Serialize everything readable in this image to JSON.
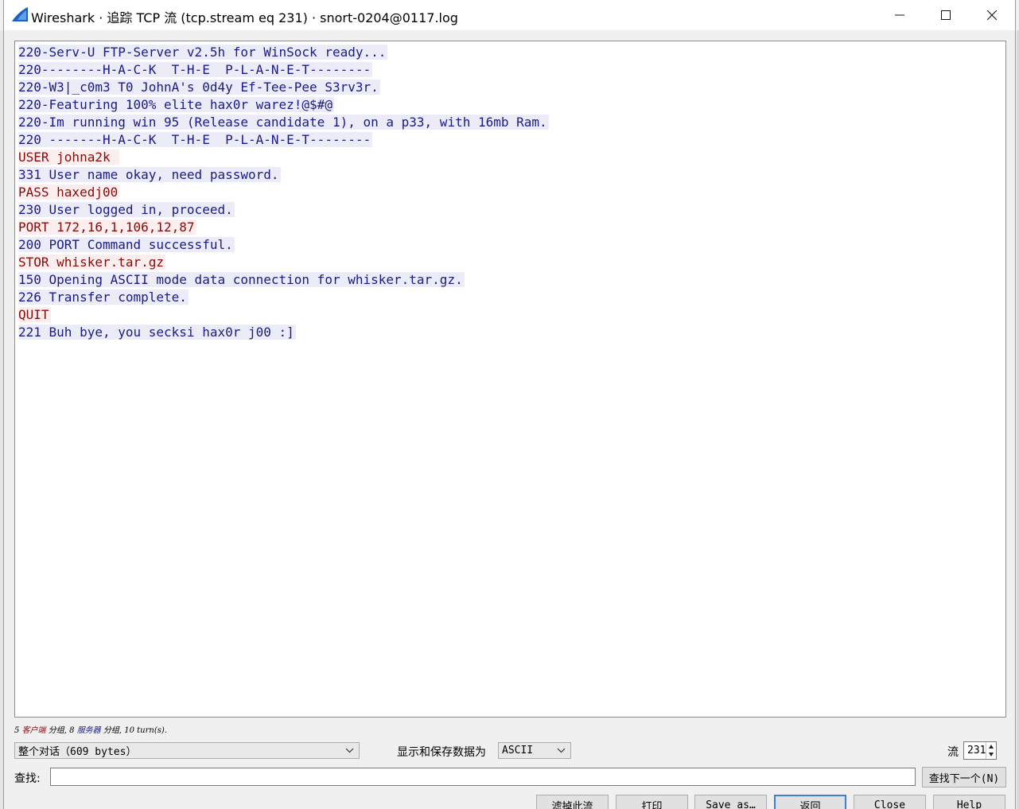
{
  "window": {
    "title": "Wireshark · 追踪 TCP 流 (tcp.stream eq 231) · snort-0204@0117.log",
    "icon": "wireshark-fin-icon",
    "controls": [
      "minimize-icon",
      "maximize-icon",
      "close-icon"
    ]
  },
  "stream": {
    "lines": [
      {
        "who": "server",
        "text": "220-Serv-U FTP-Server v2.5h for WinSock ready..."
      },
      {
        "who": "server",
        "text": "220--------H-A-C-K  T-H-E  P-L-A-N-E-T--------"
      },
      {
        "who": "server",
        "text": "220-W3|_c0m3 T0 JohnA's 0d4y Ef-Tee-Pee S3rv3r."
      },
      {
        "who": "server",
        "text": "220-Featuring 100% elite hax0r warez!@$#@"
      },
      {
        "who": "server",
        "text": "220-Im running win 95 (Release candidate 1), on a p33, with 16mb Ram."
      },
      {
        "who": "server",
        "text": "220 -------H-A-C-K  T-H-E  P-L-A-N-E-T--------"
      },
      {
        "who": "client",
        "text": "USER johna2k "
      },
      {
        "who": "server",
        "text": "331 User name okay, need password."
      },
      {
        "who": "client",
        "text": "PASS haxedj00"
      },
      {
        "who": "server",
        "text": "230 User logged in, proceed."
      },
      {
        "who": "client",
        "text": "PORT 172,16,1,106,12,87"
      },
      {
        "who": "server",
        "text": "200 PORT Command successful."
      },
      {
        "who": "client",
        "text": "STOR whisker.tar.gz"
      },
      {
        "who": "server",
        "text": "150 Opening ASCII mode data connection for whisker.tar.gz."
      },
      {
        "who": "server",
        "text": "226 Transfer complete."
      },
      {
        "who": "client",
        "text": "QUIT"
      },
      {
        "who": "server",
        "text": "221 Buh bye, you secksi hax0r j00 :]"
      }
    ]
  },
  "summary": {
    "client_count": "5",
    "client_word": "客户端",
    "mid1": "分组,",
    "server_count": "8",
    "server_word": "服务器",
    "mid2": "分组,",
    "turns": "10 turn(s)."
  },
  "controls": {
    "conversation_select": "整个对话（609 bytes）",
    "show_as_label": "显示和保存数据为",
    "show_as_select": "ASCII",
    "stream_label": "流",
    "stream_value": "231",
    "find_label": "查找:",
    "find_value": "",
    "find_next": "查找下一个(N)"
  },
  "buttons": {
    "filter_out": "滤掉此流",
    "print": "打印",
    "save_as": "Save as…",
    "back": "返回",
    "close": "Close",
    "help": "Help"
  },
  "colors": {
    "server_text": "#1a1a87",
    "server_bg": "#ececf8",
    "client_text": "#8a0a0a",
    "client_bg": "#fbeeee",
    "accent": "#3c7fd6"
  }
}
